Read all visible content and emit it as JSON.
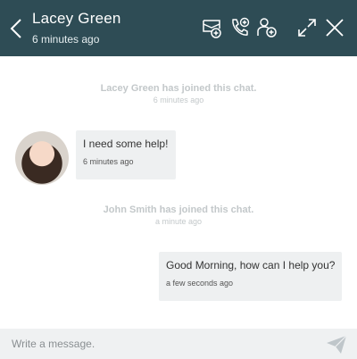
{
  "header": {
    "title": "Lacey Green",
    "subtitle": "6 minutes ago",
    "icons": [
      "back-chevron-icon",
      "add-ticket-icon",
      "add-call-icon",
      "add-user-icon",
      "expand-icon",
      "close-icon"
    ]
  },
  "messages": {
    "system1": {
      "text": "Lacey Green has joined this chat.",
      "time": "6 minutes ago"
    },
    "incoming": {
      "text": "I need some help!",
      "time": "6 minutes ago"
    },
    "system2": {
      "text": "John Smith has joined this chat.",
      "time": "a minute ago"
    },
    "outgoing": {
      "text": "Good Morning, how can I help you?",
      "time": "a few seconds ago"
    }
  },
  "composer": {
    "placeholder": "Write a message."
  },
  "colors": {
    "header_bg": "#2e4c55",
    "bubble_bg": "#eef0f1",
    "composer_bg": "#eff1f2",
    "system_text": "#c3c8ca"
  }
}
